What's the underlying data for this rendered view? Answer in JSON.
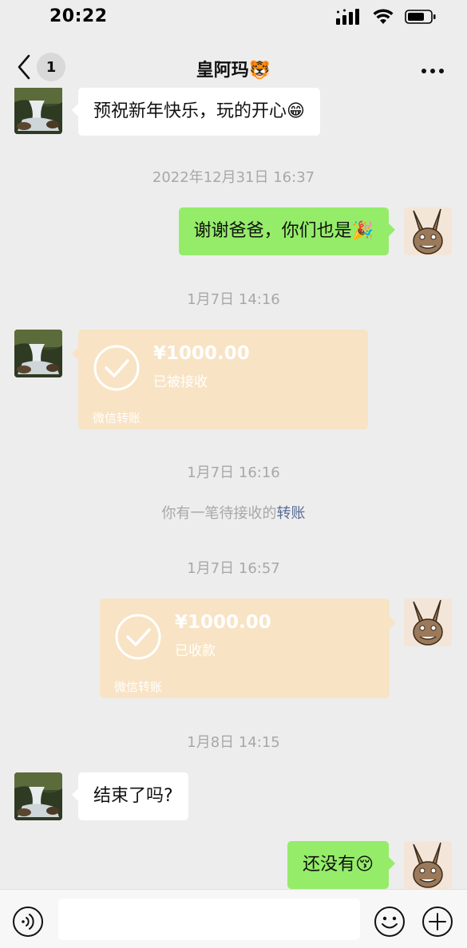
{
  "status_bar": {
    "time": "20:22"
  },
  "nav": {
    "unread_count": "1",
    "title": "皇阿玛🐯"
  },
  "messages": [
    {
      "type": "text",
      "side": "left",
      "text": "预祝新年快乐，玩的开心😁"
    },
    {
      "type": "timestamp",
      "text": "2022年12月31日 16:37"
    },
    {
      "type": "text",
      "side": "right",
      "text": "谢谢爸爸，你们也是🎉"
    },
    {
      "type": "timestamp",
      "text": "1月7日 14:16"
    },
    {
      "type": "transfer",
      "side": "left",
      "amount": "¥1000.00",
      "status": "已被接收",
      "footer": "微信转账"
    },
    {
      "type": "timestamp",
      "text": "1月7日 16:16"
    },
    {
      "type": "notice",
      "text": "你有一笔待接收的",
      "link": "转账"
    },
    {
      "type": "timestamp",
      "text": "1月7日 16:57"
    },
    {
      "type": "transfer",
      "side": "right",
      "amount": "¥1000.00",
      "status": "已收款",
      "footer": "微信转账"
    },
    {
      "type": "timestamp",
      "text": "1月8日 14:15"
    },
    {
      "type": "text",
      "side": "left",
      "text": "结束了吗?"
    },
    {
      "type": "text",
      "side": "right",
      "text": "还没有😚"
    }
  ],
  "input": {
    "value": ""
  },
  "colors": {
    "background": "#ededed",
    "my_bubble": "#95ec69",
    "their_bubble": "#ffffff",
    "transfer_card": "#f8e3c4",
    "link": "#576b95",
    "timestamp": "#a8a8a8"
  },
  "icons": [
    "back-chevron-icon",
    "more-icon",
    "signal-icon",
    "wifi-icon",
    "battery-icon",
    "voice-icon",
    "emoji-icon",
    "plus-icon",
    "check-circle-icon"
  ]
}
